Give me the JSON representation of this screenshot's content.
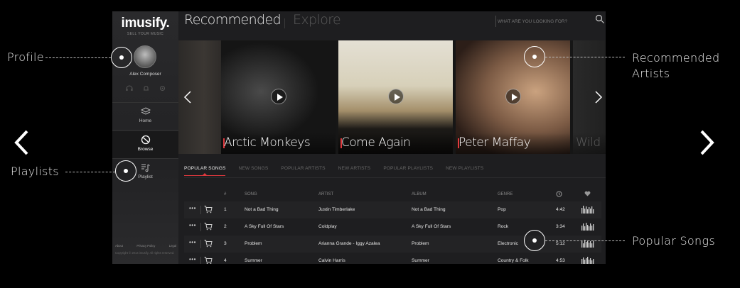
{
  "sidebar": {
    "logo": "imusify.",
    "tagline": "SELL YOUR MUSIC",
    "user": "Alex Composer",
    "nav": [
      {
        "label": "Home",
        "icon": "layers-icon"
      },
      {
        "label": "Browse",
        "icon": "compass-icon"
      },
      {
        "label": "Playlist",
        "icon": "playlist-icon"
      }
    ],
    "footer_links": [
      "About",
      "Privacy Policy",
      "Legal"
    ],
    "copyright": "Copyright © 2014 imusify. All rights reserved."
  },
  "header": {
    "tab_recommended": "Recommended",
    "tab_explore": "Explore",
    "search_placeholder": "WHAT ARE YOU LOOKING FOR?"
  },
  "carousel": {
    "cards": [
      "Arctic Monkeys",
      "Come Again",
      "Peter Maffay",
      "Wild"
    ]
  },
  "tabs": [
    "POPULAR SONGS",
    "NEW SONGS",
    "POPULAR ARTISTS",
    "NEW ARTISTS",
    "POPULAR PLAYLISTS",
    "NEW PLAYLISTS"
  ],
  "table": {
    "headers": {
      "num": "#",
      "song": "SONG",
      "artist": "ARTIST",
      "album": "ALBUM",
      "genre": "GENRE"
    },
    "rows": [
      {
        "num": "1",
        "song": "Not a Bad Thing",
        "artist": "Justin Timberlake",
        "album": "Not a Bad Thing",
        "genre": "Pop",
        "time": "4:42"
      },
      {
        "num": "2",
        "song": "A Sky Full Of Stars",
        "artist": "Coldplay",
        "album": "A Sky Full Of Stars",
        "genre": "Rock",
        "time": "3:34"
      },
      {
        "num": "3",
        "song": "Problem",
        "artist": "Arianna Grande - Iggy Azalea",
        "album": "Problem",
        "genre": "Electronic",
        "time": "5:12"
      },
      {
        "num": "4",
        "song": "Summer",
        "artist": "Calvin Harris",
        "album": "Summer",
        "genre": "Country & Folk",
        "time": "4:53"
      }
    ]
  },
  "annotations": {
    "profile": "Profile",
    "playlists": "Playlists",
    "recommended_line1": "Recommended",
    "recommended_line2": "Artists",
    "popular_songs": "Popular Songs"
  },
  "colors": {
    "accent": "#e0393e",
    "background": "#000000",
    "app_bg": "#1e1e20"
  }
}
